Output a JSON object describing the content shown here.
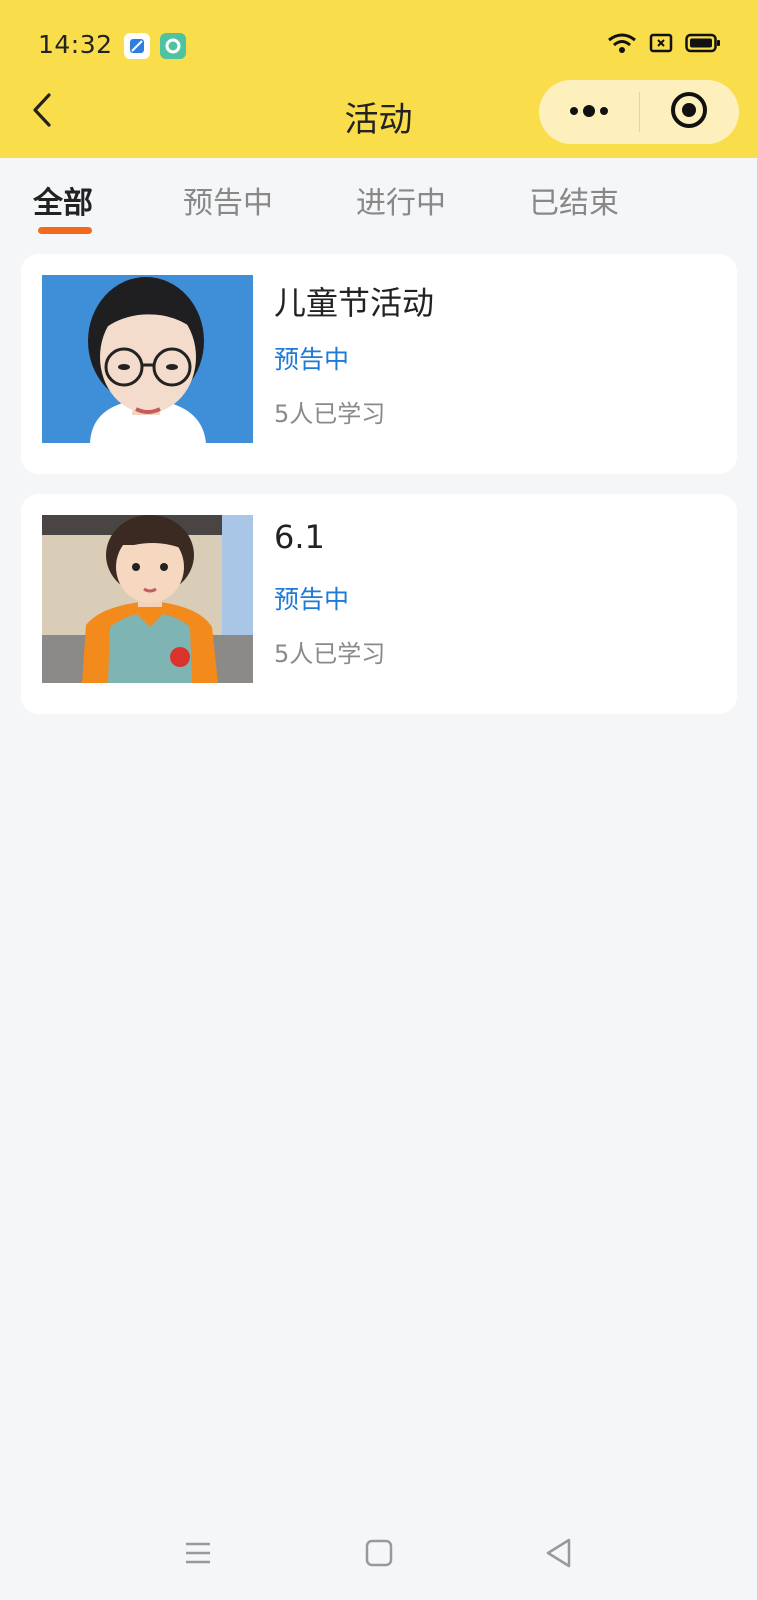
{
  "status_bar": {
    "time": "14:32",
    "icons": [
      "app-notification-icon",
      "app-notification-icon",
      "wifi-icon",
      "sim-card-icon",
      "battery-icon"
    ]
  },
  "header": {
    "title": "活动",
    "background_color": "#fadd4a",
    "capsule_icons": [
      "more-dots-icon",
      "close-target-icon"
    ]
  },
  "tabs": [
    {
      "label": "全部",
      "active": true
    },
    {
      "label": "预告中",
      "active": false
    },
    {
      "label": "进行中",
      "active": false
    },
    {
      "label": "已结束",
      "active": false
    }
  ],
  "accent_color": "#f26b1d",
  "status_color": "#1f7ad6",
  "activities": [
    {
      "title": "儿童节活动",
      "status": "预告中",
      "learners": "5人已学习",
      "thumbnail": "portrait-photo"
    },
    {
      "title": "6.1",
      "status": "预告中",
      "learners": "5人已学习",
      "thumbnail": "child-photo"
    }
  ],
  "nav_bar": {
    "icons": [
      "menu-icon",
      "home-icon",
      "back-triangle-icon"
    ]
  }
}
